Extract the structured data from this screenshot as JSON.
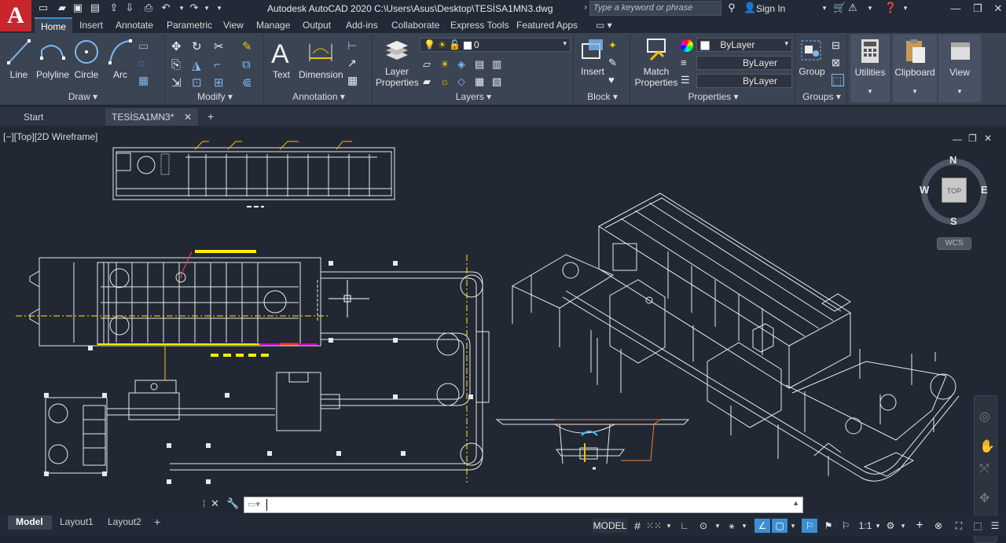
{
  "app": {
    "logo_letter": "A",
    "title": "Autodesk AutoCAD 2020    C:\\Users\\Asus\\Desktop\\TESİSA1MN3.dwg",
    "search_placeholder": "Type a keyword or phrase",
    "sign_in": "Sign In"
  },
  "quick_access": [
    "new-icon",
    "open-icon",
    "save-icon",
    "saveas-icon",
    "plot-icon",
    "undo-icon",
    "redo-icon"
  ],
  "menu_tabs": [
    "Home",
    "Insert",
    "Annotate",
    "Parametric",
    "View",
    "Manage",
    "Output",
    "Add-ins",
    "Collaborate",
    "Express Tools",
    "Featured Apps"
  ],
  "ribbon": {
    "draw": {
      "title": "Draw",
      "line": "Line",
      "polyline": "Polyline",
      "circle": "Circle",
      "arc": "Arc"
    },
    "modify": {
      "title": "Modify"
    },
    "annotation": {
      "title": "Annotation",
      "text": "Text",
      "dimension": "Dimension"
    },
    "layers": {
      "title": "Layers",
      "layer_properties_1": "Layer",
      "layer_properties_2": "Properties",
      "current_layer": "0"
    },
    "block": {
      "title": "Block",
      "insert": "Insert"
    },
    "properties": {
      "title": "Properties",
      "match_1": "Match",
      "match_2": "Properties",
      "color": "ByLayer",
      "linetype": "ByLayer",
      "lineweight": "ByLayer"
    },
    "groups": {
      "title": "Groups",
      "group": "Group"
    },
    "utilities": "Utilities",
    "clipboard": "Clipboard",
    "view": "View"
  },
  "doc_tabs": {
    "start": "Start",
    "current": "TESİSA1MN3*",
    "close": "✕",
    "add": "+"
  },
  "viewport": {
    "label": "[−][Top][2D Wireframe]",
    "compass": {
      "n": "N",
      "s": "S",
      "e": "E",
      "w": "W",
      "top": "TOP",
      "wcs": "WCS"
    }
  },
  "layout_tabs": {
    "model": "Model",
    "layout1": "Layout1",
    "layout2": "Layout2",
    "add": "+"
  },
  "status": {
    "model": "MODEL",
    "scale": "1:1"
  },
  "colors": {
    "accent": "#3a8fd1",
    "yellow": "#ffee00",
    "ribbon": "#3b4453",
    "canvas": "#212833",
    "red": "#c8252d"
  }
}
